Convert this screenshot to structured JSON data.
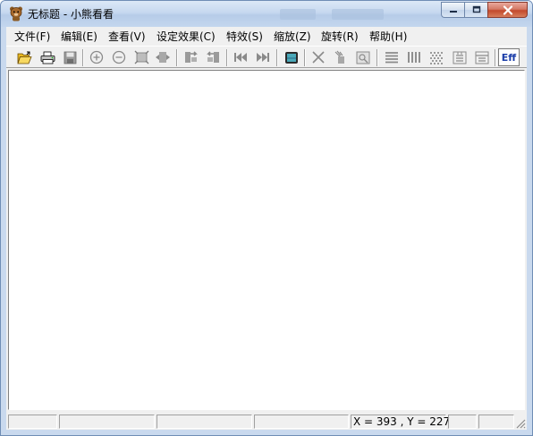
{
  "window": {
    "title": "无标题 - 小熊看看"
  },
  "menubar": {
    "items": [
      {
        "label": "文件(F)"
      },
      {
        "label": "编辑(E)"
      },
      {
        "label": "查看(V)"
      },
      {
        "label": "设定效果(C)"
      },
      {
        "label": "特效(S)"
      },
      {
        "label": "缩放(Z)"
      },
      {
        "label": "旋转(R)"
      },
      {
        "label": "帮助(H)"
      }
    ]
  },
  "toolbar": {
    "icons": [
      "open-folder-icon",
      "print-icon",
      "save-icon",
      "zoom-in-icon",
      "zoom-out-icon",
      "fit-window-icon",
      "actual-size-icon",
      "rotate-left-icon",
      "rotate-right-icon",
      "previous-image-icon",
      "next-image-icon",
      "fullscreen-icon",
      "delete-icon",
      "paint-icon",
      "thumbnail-icon",
      "horizontal-lines-icon",
      "vertical-lines-icon",
      "mosaic-icon",
      "effect-a-icon",
      "effect-b-icon"
    ],
    "effect_label": "Eff"
  },
  "statusbar": {
    "coords": "X = 393 , Y = 227"
  },
  "colors": {
    "accent": "#1a3ca8",
    "close_button": "#c2492c"
  }
}
